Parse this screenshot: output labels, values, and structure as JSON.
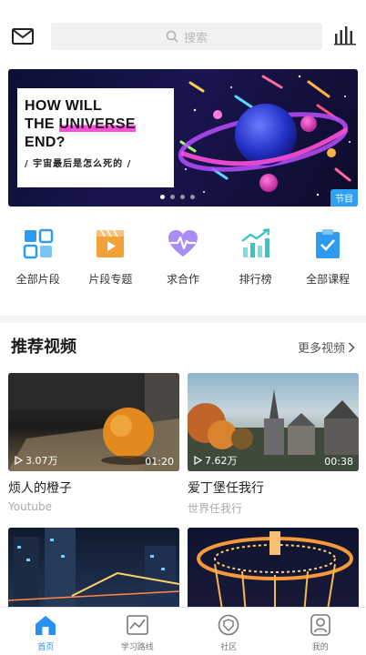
{
  "header": {
    "mail_icon": "mail-icon",
    "search_placeholder": "搜索",
    "stats_icon": "stats-icon"
  },
  "banner": {
    "line1": "HOW WILL",
    "line2a": "THE ",
    "line2b": "UNIVERSE",
    "line3": "END?",
    "subtitle": "/ 宇宙最后是怎么死的 /",
    "tag": "节目",
    "pages": 4,
    "active_page": 1
  },
  "quick_links": [
    {
      "label": "全部片段",
      "icon": "grid-icon",
      "color": "#2e9bf0"
    },
    {
      "label": "片段专题",
      "icon": "video-icon",
      "color": "#f5a13a"
    },
    {
      "label": "求合作",
      "icon": "heart-pulse-icon",
      "color": "#8e6cf2"
    },
    {
      "label": "排行榜",
      "icon": "trend-chart-icon",
      "color": "#34c6c6"
    },
    {
      "label": "全部课程",
      "icon": "clipboard-icon",
      "color": "#2e9bf0"
    }
  ],
  "recommended": {
    "title": "推荐视频",
    "more": "更多视频"
  },
  "videos": [
    {
      "title": "烦人的橙子",
      "source": "Youtube",
      "views": "3.07万",
      "duration": "01:20"
    },
    {
      "title": "爱丁堡任我行",
      "source": "世界任我行",
      "views": "7.62万",
      "duration": "00:38"
    }
  ],
  "tabs": [
    {
      "label": "首页",
      "active": true
    },
    {
      "label": "学习路线",
      "active": false
    },
    {
      "label": "社区",
      "active": false
    },
    {
      "label": "我的",
      "active": false
    }
  ]
}
